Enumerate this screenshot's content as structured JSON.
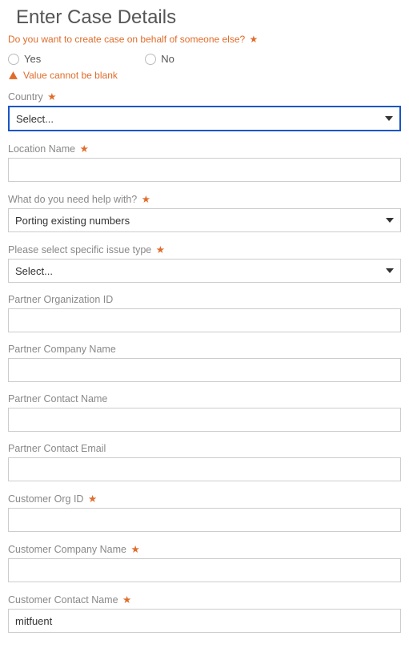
{
  "heading": "Enter Case Details",
  "behalf_question": "Do you want to create case on behalf of someone else?",
  "radio": {
    "yes": "Yes",
    "no": "No"
  },
  "error_blank": "Value cannot be blank",
  "fields": {
    "country": {
      "label": "Country",
      "placeholder": "Select..."
    },
    "location_name": {
      "label": "Location Name",
      "value": ""
    },
    "help_with": {
      "label": "What do you need help with?",
      "selected": "Porting existing numbers"
    },
    "issue_type": {
      "label": "Please select specific issue type",
      "placeholder": "Select..."
    },
    "partner_org_id": {
      "label": "Partner Organization ID",
      "value": ""
    },
    "partner_company": {
      "label": "Partner Company Name",
      "value": ""
    },
    "partner_contact_name": {
      "label": "Partner Contact Name",
      "value": ""
    },
    "partner_contact_email": {
      "label": "Partner Contact Email",
      "value": ""
    },
    "customer_org_id": {
      "label": "Customer Org ID",
      "value": ""
    },
    "customer_company": {
      "label": "Customer Company Name",
      "value": ""
    },
    "customer_contact_name": {
      "label": "Customer Contact Name",
      "value": "mitfuent"
    }
  }
}
